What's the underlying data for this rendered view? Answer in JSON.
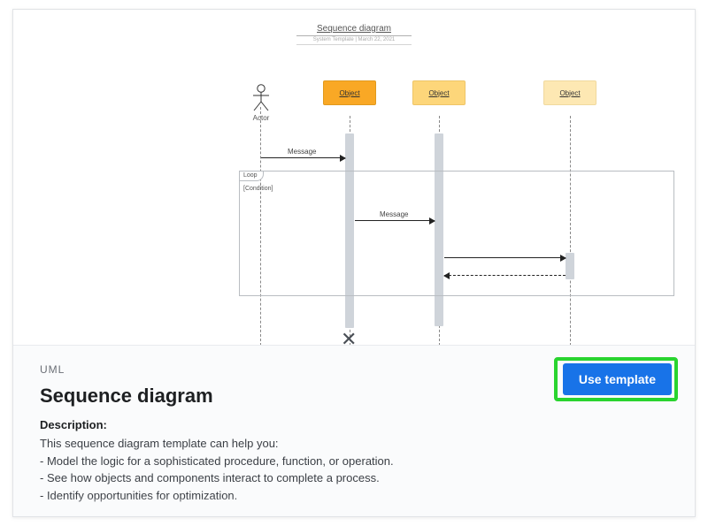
{
  "diagram": {
    "title": "Sequence diagram",
    "subtitle": "System Template | March 22, 2021",
    "actor_label": "Actor",
    "objects": [
      {
        "label": "Object"
      },
      {
        "label": "Object"
      },
      {
        "label": "Object"
      }
    ],
    "messages": {
      "m1": "Message",
      "m2": "Message"
    },
    "loop": {
      "tab": "Loop",
      "condition": "[Condition]"
    }
  },
  "info": {
    "category": "UML",
    "title": "Sequence diagram",
    "desc_heading": "Description:",
    "desc_intro": "This sequence diagram template can help you:",
    "desc_bullets": [
      "- Model the logic for a sophisticated procedure, function, or operation.",
      "- See how objects and components interact to complete a process.",
      "- Identify opportunities for optimization."
    ],
    "use_button": "Use template"
  }
}
